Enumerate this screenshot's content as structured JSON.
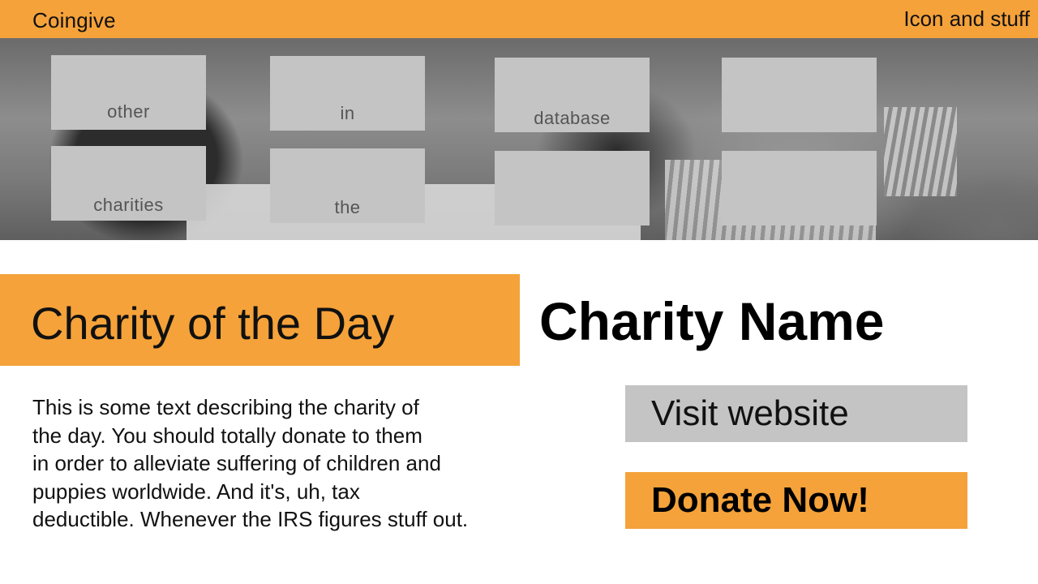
{
  "header": {
    "brand": "Coingive",
    "right_text": "Icon and stuff"
  },
  "hero": {
    "tiles": [
      "other",
      "in",
      "database",
      "",
      "charities",
      "the",
      "",
      ""
    ]
  },
  "featured": {
    "section_title": "Charity of the Day",
    "charity_name": "Charity Name",
    "description_lines": [
      "This is some text describing the charity of",
      "the day. You should totally donate to them",
      "in order to alleviate suffering of children and",
      "puppies worldwide. And it's, uh, tax",
      "deductible. Whenever the IRS figures stuff out."
    ],
    "visit_label": "Visit website",
    "donate_label": "Donate Now!"
  },
  "colors": {
    "accent": "#f5a23a",
    "tile_gray": "#c4c4c4"
  }
}
